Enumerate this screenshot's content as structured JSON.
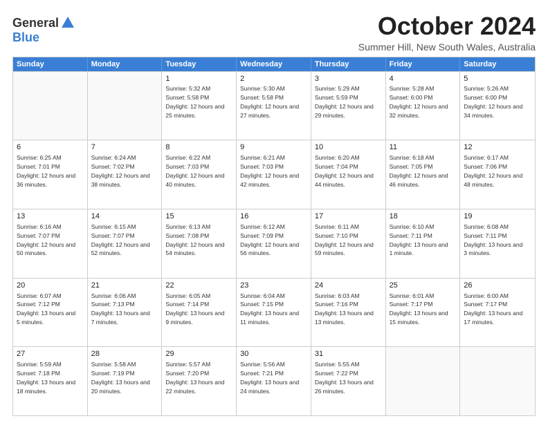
{
  "logo": {
    "line1": "General",
    "line2": "Blue"
  },
  "title": "October 2024",
  "location": "Summer Hill, New South Wales, Australia",
  "header_days": [
    "Sunday",
    "Monday",
    "Tuesday",
    "Wednesday",
    "Thursday",
    "Friday",
    "Saturday"
  ],
  "rows": [
    [
      {
        "day": "",
        "empty": true
      },
      {
        "day": "",
        "empty": true
      },
      {
        "day": "1",
        "rise": "5:32 AM",
        "set": "5:58 PM",
        "daylight": "12 hours and 25 minutes."
      },
      {
        "day": "2",
        "rise": "5:30 AM",
        "set": "5:58 PM",
        "daylight": "12 hours and 27 minutes."
      },
      {
        "day": "3",
        "rise": "5:29 AM",
        "set": "5:59 PM",
        "daylight": "12 hours and 29 minutes."
      },
      {
        "day": "4",
        "rise": "5:28 AM",
        "set": "6:00 PM",
        "daylight": "12 hours and 32 minutes."
      },
      {
        "day": "5",
        "rise": "5:26 AM",
        "set": "6:00 PM",
        "daylight": "12 hours and 34 minutes."
      }
    ],
    [
      {
        "day": "6",
        "rise": "6:25 AM",
        "set": "7:01 PM",
        "daylight": "12 hours and 36 minutes."
      },
      {
        "day": "7",
        "rise": "6:24 AM",
        "set": "7:02 PM",
        "daylight": "12 hours and 38 minutes."
      },
      {
        "day": "8",
        "rise": "6:22 AM",
        "set": "7:03 PM",
        "daylight": "12 hours and 40 minutes."
      },
      {
        "day": "9",
        "rise": "6:21 AM",
        "set": "7:03 PM",
        "daylight": "12 hours and 42 minutes."
      },
      {
        "day": "10",
        "rise": "6:20 AM",
        "set": "7:04 PM",
        "daylight": "12 hours and 44 minutes."
      },
      {
        "day": "11",
        "rise": "6:18 AM",
        "set": "7:05 PM",
        "daylight": "12 hours and 46 minutes."
      },
      {
        "day": "12",
        "rise": "6:17 AM",
        "set": "7:06 PM",
        "daylight": "12 hours and 48 minutes."
      }
    ],
    [
      {
        "day": "13",
        "rise": "6:16 AM",
        "set": "7:07 PM",
        "daylight": "12 hours and 50 minutes."
      },
      {
        "day": "14",
        "rise": "6:15 AM",
        "set": "7:07 PM",
        "daylight": "12 hours and 52 minutes."
      },
      {
        "day": "15",
        "rise": "6:13 AM",
        "set": "7:08 PM",
        "daylight": "12 hours and 54 minutes."
      },
      {
        "day": "16",
        "rise": "6:12 AM",
        "set": "7:09 PM",
        "daylight": "12 hours and 56 minutes."
      },
      {
        "day": "17",
        "rise": "6:11 AM",
        "set": "7:10 PM",
        "daylight": "12 hours and 59 minutes."
      },
      {
        "day": "18",
        "rise": "6:10 AM",
        "set": "7:11 PM",
        "daylight": "13 hours and 1 minute."
      },
      {
        "day": "19",
        "rise": "6:08 AM",
        "set": "7:11 PM",
        "daylight": "13 hours and 3 minutes."
      }
    ],
    [
      {
        "day": "20",
        "rise": "6:07 AM",
        "set": "7:12 PM",
        "daylight": "13 hours and 5 minutes."
      },
      {
        "day": "21",
        "rise": "6:06 AM",
        "set": "7:13 PM",
        "daylight": "13 hours and 7 minutes."
      },
      {
        "day": "22",
        "rise": "6:05 AM",
        "set": "7:14 PM",
        "daylight": "13 hours and 9 minutes."
      },
      {
        "day": "23",
        "rise": "6:04 AM",
        "set": "7:15 PM",
        "daylight": "13 hours and 11 minutes."
      },
      {
        "day": "24",
        "rise": "6:03 AM",
        "set": "7:16 PM",
        "daylight": "13 hours and 13 minutes."
      },
      {
        "day": "25",
        "rise": "6:01 AM",
        "set": "7:17 PM",
        "daylight": "13 hours and 15 minutes."
      },
      {
        "day": "26",
        "rise": "6:00 AM",
        "set": "7:17 PM",
        "daylight": "13 hours and 17 minutes."
      }
    ],
    [
      {
        "day": "27",
        "rise": "5:59 AM",
        "set": "7:18 PM",
        "daylight": "13 hours and 18 minutes."
      },
      {
        "day": "28",
        "rise": "5:58 AM",
        "set": "7:19 PM",
        "daylight": "13 hours and 20 minutes."
      },
      {
        "day": "29",
        "rise": "5:57 AM",
        "set": "7:20 PM",
        "daylight": "13 hours and 22 minutes."
      },
      {
        "day": "30",
        "rise": "5:56 AM",
        "set": "7:21 PM",
        "daylight": "13 hours and 24 minutes."
      },
      {
        "day": "31",
        "rise": "5:55 AM",
        "set": "7:22 PM",
        "daylight": "13 hours and 26 minutes."
      },
      {
        "day": "",
        "empty": true
      },
      {
        "day": "",
        "empty": true
      }
    ]
  ]
}
